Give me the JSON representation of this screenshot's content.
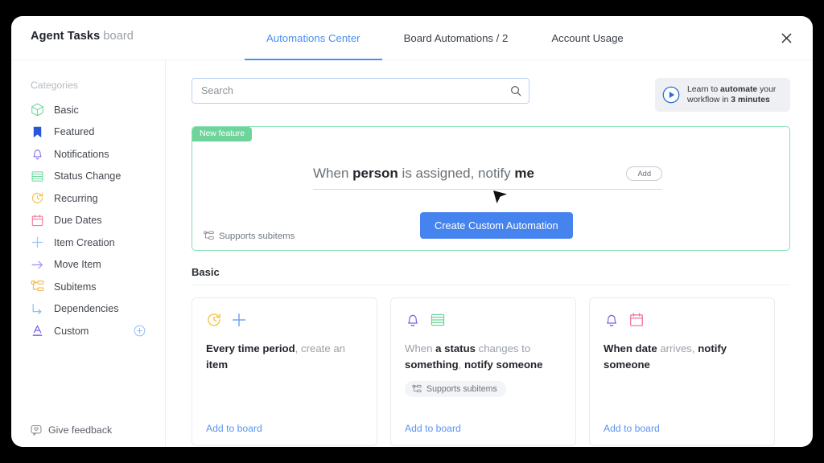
{
  "header": {
    "board_name": "Agent Tasks",
    "board_suffix": "board",
    "tabs": [
      {
        "label": "Automations Center",
        "active": true
      },
      {
        "label": "Board Automations / 2",
        "active": false
      },
      {
        "label": "Account Usage",
        "active": false
      }
    ],
    "close_label": "✕"
  },
  "sidebar": {
    "heading": "Categories",
    "items": [
      {
        "label": "Basic",
        "icon": "cube-icon",
        "color": "#6fd49c"
      },
      {
        "label": "Featured",
        "icon": "bookmark-icon",
        "color": "#2b55d8"
      },
      {
        "label": "Notifications",
        "icon": "bell-icon",
        "color": "#7b61e8"
      },
      {
        "label": "Status Change",
        "icon": "status-bars-icon",
        "color": "#6fd49c"
      },
      {
        "label": "Recurring",
        "icon": "recurring-clock-icon",
        "color": "#f6c445"
      },
      {
        "label": "Due Dates",
        "icon": "calendar-icon",
        "color": "#f username placeholder"
      },
      {
        "label": "Item Creation",
        "icon": "plus-icon",
        "color": "#9cc5f5"
      },
      {
        "label": "Move Item",
        "icon": "arrow-right-icon",
        "color": "#a78bf0"
      },
      {
        "label": "Subitems",
        "icon": "subitems-icon",
        "color": "#f3b24a"
      },
      {
        "label": "Dependencies",
        "icon": "dependency-icon",
        "color": "#7fb8f5"
      },
      {
        "label": "Custom",
        "icon": "underline-a-icon",
        "color": "#7b61e8",
        "add_icon": "circle-plus-icon"
      }
    ],
    "feedback": {
      "label": "Give feedback",
      "icon": "feedback-bubble-icon"
    }
  },
  "search": {
    "placeholder": "Search",
    "value": "",
    "icon": "search-icon"
  },
  "promo": {
    "icon": "play-circle-icon",
    "line1_pre": "Learn to ",
    "line1_bold": "automate",
    "line1_post": " your",
    "line2_pre": "workflow in ",
    "line2_bold": "3 minutes"
  },
  "banner": {
    "badge": "New feature",
    "recipe": {
      "pre": "When ",
      "b1": "person",
      "mid": " is assigned, notify ",
      "b2": "me"
    },
    "add_button": "Add",
    "cta": "Create Custom Automation",
    "subitems_note": "Supports subitems",
    "subitems_icon": "subitems-icon",
    "border_color": "#86dfae",
    "badge_color": "#6fd49c",
    "cta_color": "#4583ef"
  },
  "section": {
    "title": "Basic"
  },
  "cards": [
    {
      "icons": [
        {
          "name": "recurring-clock-icon",
          "color": "#f6c445"
        },
        {
          "name": "plus-icon",
          "color": "#6aa8f5"
        }
      ],
      "text_parts": [
        {
          "t": "Every time period",
          "bold": true
        },
        {
          "t": ", create an ",
          "bold": false
        },
        {
          "t": "item",
          "bold": true
        }
      ],
      "chip": null,
      "link": "Add to board"
    },
    {
      "icons": [
        {
          "name": "bell-icon",
          "color": "#7b61e8"
        },
        {
          "name": "status-bars-icon",
          "color": "#6fd49c"
        }
      ],
      "text_parts": [
        {
          "t": "When ",
          "bold": false
        },
        {
          "t": "a status",
          "bold": true
        },
        {
          "t": " changes to ",
          "bold": false
        },
        {
          "t": "something",
          "bold": true
        },
        {
          "t": ", ",
          "bold": false
        },
        {
          "t": "notify someone",
          "bold": true
        }
      ],
      "chip": {
        "label": "Supports subitems",
        "icon": "subitems-icon"
      },
      "link": "Add to board"
    },
    {
      "icons": [
        {
          "name": "bell-icon",
          "color": "#7b61e8"
        },
        {
          "name": "calendar-icon",
          "color": "#f07b9a"
        }
      ],
      "text_parts": [
        {
          "t": "When date",
          "bold": true
        },
        {
          "t": " arrives, ",
          "bold": false
        },
        {
          "t": "notify someone",
          "bold": true
        }
      ],
      "chip": null,
      "link": "Add to board"
    }
  ]
}
